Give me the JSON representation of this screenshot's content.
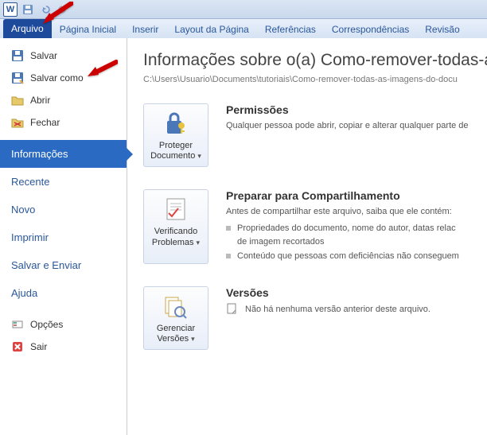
{
  "ribbon": {
    "tabs": [
      "Arquivo",
      "Página Inicial",
      "Inserir",
      "Layout da Página",
      "Referências",
      "Correspondências",
      "Revisão"
    ]
  },
  "left_menu": {
    "save": "Salvar",
    "save_as": "Salvar como",
    "open": "Abrir",
    "close": "Fechar",
    "info": "Informações",
    "recent": "Recente",
    "new": "Novo",
    "print": "Imprimir",
    "save_send": "Salvar e Enviar",
    "help": "Ajuda",
    "options": "Opções",
    "exit": "Sair"
  },
  "main": {
    "title": "Informações sobre o(a) Como-remover-todas-a",
    "path": "C:\\Users\\Usuario\\Documents\\tutoriais\\Como-remover-todas-as-imagens-do-docu",
    "permissions": {
      "button": "Proteger Documento",
      "heading": "Permissões",
      "text": "Qualquer pessoa pode abrir, copiar e alterar qualquer parte de"
    },
    "prepare": {
      "button": "Verificando Problemas",
      "heading": "Preparar para Compartilhamento",
      "text": "Antes de compartilhar este arquivo, saiba que ele contém:",
      "bullets": [
        "Propriedades do documento, nome do autor, datas relac",
        "de imagem recortados",
        "Conteúdo que pessoas com deficiências não conseguem"
      ]
    },
    "versions": {
      "button": "Gerenciar Versões",
      "heading": "Versões",
      "text": "Não há nenhuma versão anterior deste arquivo."
    }
  }
}
